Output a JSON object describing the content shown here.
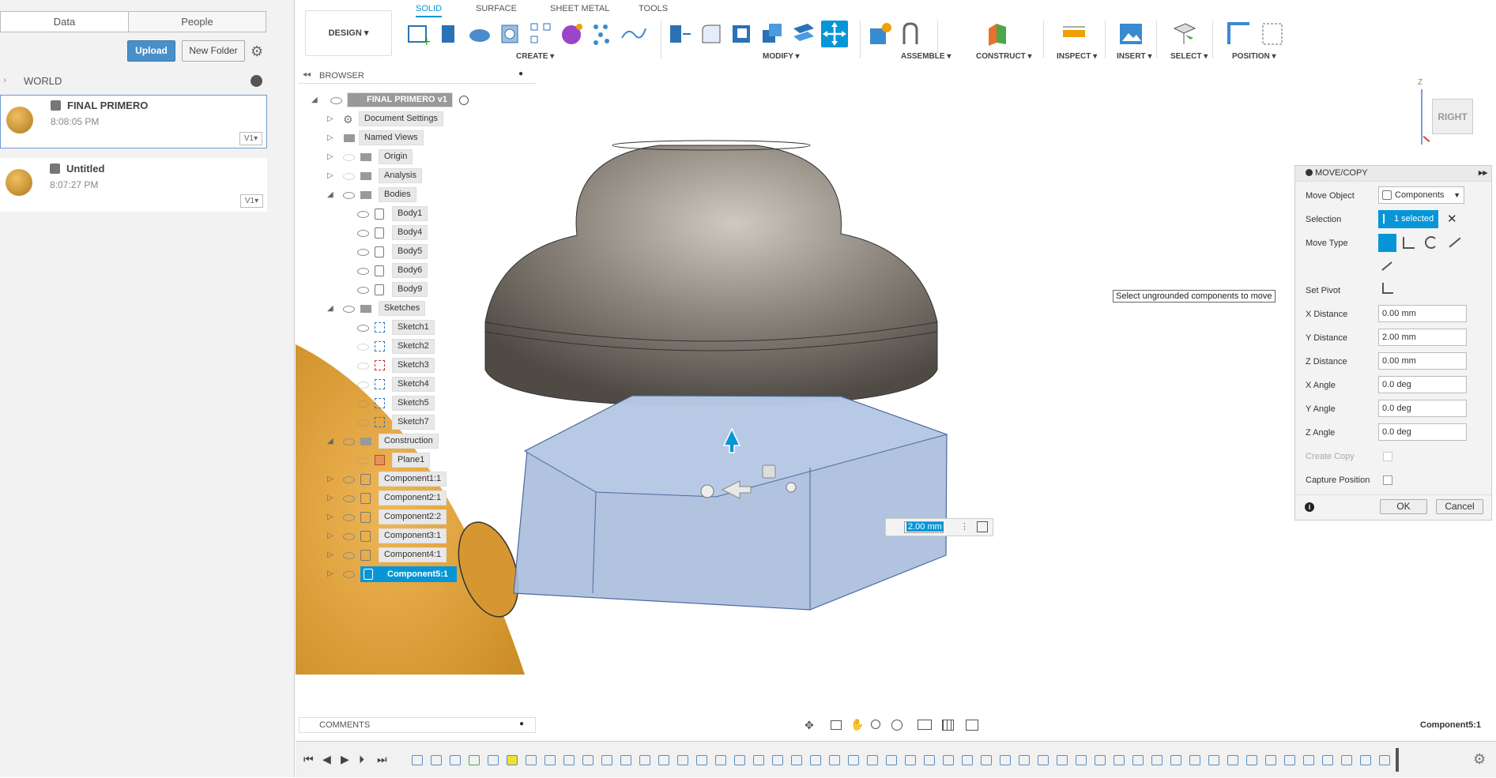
{
  "data_panel": {
    "tabs": [
      "Data",
      "People"
    ],
    "upload_label": "Upload",
    "new_folder_label": "New Folder",
    "location": "WORLD",
    "files": [
      {
        "name": "FINAL PRIMERO",
        "time": "8:08:05 PM",
        "version": "V1▾"
      },
      {
        "name": "Untitled",
        "time": "8:07:27 PM",
        "version": "V1▾"
      }
    ]
  },
  "toolbar": {
    "workspace_label": "DESIGN ▾",
    "tabs": [
      "SOLID",
      "SURFACE",
      "SHEET METAL",
      "TOOLS"
    ],
    "groups": [
      "CREATE ▾",
      "MODIFY ▾",
      "ASSEMBLE ▾",
      "CONSTRUCT ▾",
      "INSPECT ▾",
      "INSERT ▾",
      "SELECT ▾",
      "POSITION ▾"
    ]
  },
  "browser": {
    "title": "BROWSER",
    "root": "FINAL PRIMERO v1",
    "items": [
      "Document Settings",
      "Named Views",
      "Origin",
      "Analysis",
      "Bodies",
      "Body1",
      "Body4",
      "Body5",
      "Body6",
      "Body9",
      "Sketches",
      "Sketch1",
      "Sketch2",
      "Sketch3",
      "Sketch4",
      "Sketch5",
      "Sketch7",
      "Construction",
      "Plane1",
      "Component1:1",
      "Component2:1",
      "Component2:2",
      "Component3:1",
      "Component4:1",
      "Component5:1"
    ]
  },
  "comments_label": "COMMENTS",
  "viewcube_label": "RIGHT",
  "viewcube_axis": "Z",
  "tooltip": "Select ungrounded components to move",
  "distance_input": "2.00 mm",
  "move_panel": {
    "title": "MOVE/COPY",
    "fields": {
      "move_object_label": "Move Object",
      "move_object_value": "Components",
      "selection_label": "Selection",
      "selection_value": "1 selected",
      "move_type_label": "Move Type",
      "set_pivot_label": "Set Pivot",
      "x_distance_label": "X Distance",
      "x_distance_value": "0.00 mm",
      "y_distance_label": "Y Distance",
      "y_distance_value": "2.00 mm",
      "z_distance_label": "Z Distance",
      "z_distance_value": "0.00 mm",
      "x_angle_label": "X Angle",
      "x_angle_value": "0.0 deg",
      "y_angle_label": "Y Angle",
      "y_angle_value": "0.0 deg",
      "z_angle_label": "Z Angle",
      "z_angle_value": "0.0 deg",
      "create_copy_label": "Create Copy",
      "capture_position_label": "Capture Position"
    },
    "ok_label": "OK",
    "cancel_label": "Cancel"
  },
  "status_selection": "Component5:1",
  "colors": {
    "accent": "#0696d7",
    "upload": "#4a90c8",
    "body_gray": "#8a857c",
    "hex_blue": "#a9bedc",
    "sphere": "#e4a43c"
  }
}
